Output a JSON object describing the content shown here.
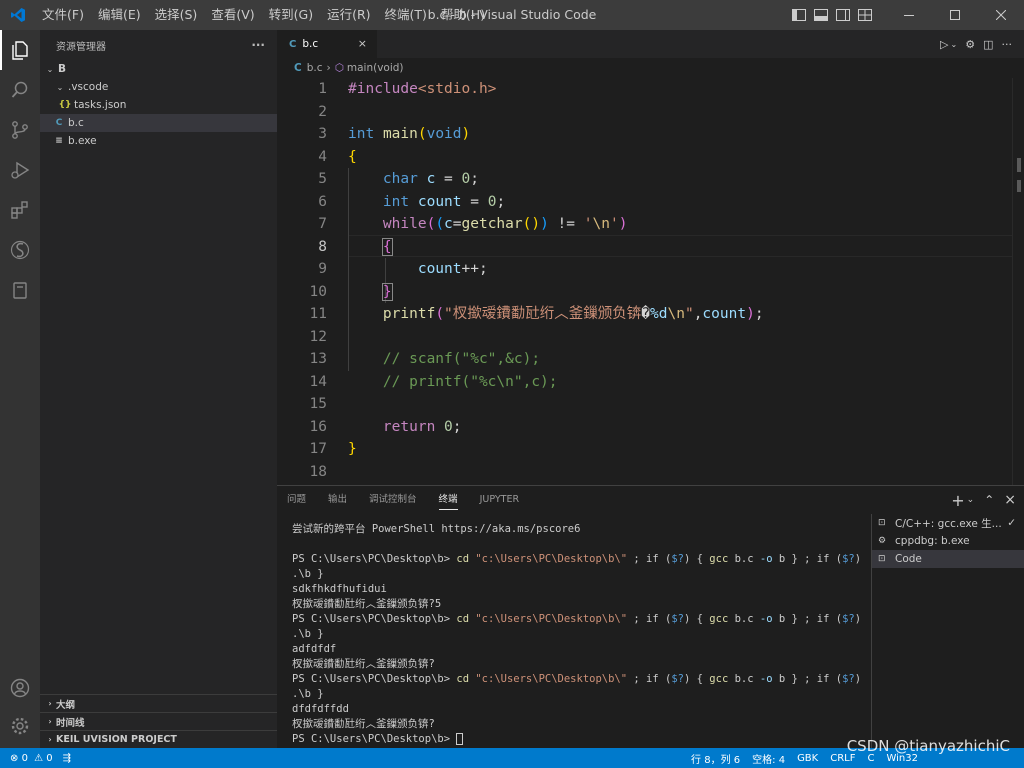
{
  "titlebar": {
    "menu": [
      "文件(F)",
      "编辑(E)",
      "选择(S)",
      "查看(V)",
      "转到(G)",
      "运行(R)",
      "终端(T)",
      "帮助(H)"
    ],
    "title": "b.c - b - Visual Studio Code"
  },
  "sidebar": {
    "header": "资源管理器",
    "more": "···",
    "tree": [
      {
        "label": "B",
        "twisty": "⌄",
        "icon": ""
      },
      {
        "label": ".vscode",
        "twisty": "⌄",
        "icon": ""
      },
      {
        "label": "tasks.json",
        "twisty": "",
        "icon": "{}"
      },
      {
        "label": "b.c",
        "twisty": "",
        "icon": "C"
      },
      {
        "label": "b.exe",
        "twisty": "",
        "icon": "≡"
      }
    ],
    "panels": [
      "大纲",
      "时间线",
      "KEIL UVISION PROJECT"
    ]
  },
  "editor": {
    "tab": {
      "icon": "C",
      "label": "b.c",
      "close": "×"
    },
    "breadcrumb": {
      "file": "b.c",
      "symbol": "main(void)",
      "sep": "›"
    },
    "line_numbers": [
      "1",
      "2",
      "3",
      "4",
      "5",
      "6",
      "7",
      "8",
      "9",
      "10",
      "11",
      "12",
      "13",
      "14",
      "15",
      "16",
      "17",
      "18"
    ]
  },
  "panel": {
    "tabs": [
      "问题",
      "输出",
      "调试控制台",
      "终端",
      "JUPYTER"
    ],
    "actions": {
      "add": "+",
      "chevron": "⌄",
      "split": "⌃",
      "close": "×"
    },
    "terminal_lines": [
      "尝试新的跨平台 PowerShell https://aka.ms/pscore6",
      "",
      "PS C:\\Users\\PC\\Desktop\\b> cd \"c:\\Users\\PC\\Desktop\\b\\\" ; if ($?) { gcc b.c -o b } ; if ($?) {",
      ".\\b }",
      "sdkfhkdfhufidui",
      "杈撳叆鐨勫瓧绗︿釜鏁颁负锛?5",
      "PS C:\\Users\\PC\\Desktop\\b> cd \"c:\\Users\\PC\\Desktop\\b\\\" ; if ($?) { gcc b.c -o b } ; if ($?) {",
      ".\\b }",
      "adfdfdf",
      "杈撳叆鐨勫瓧绗︿釜鏁颁负锛?",
      "PS C:\\Users\\PC\\Desktop\\b> cd \"c:\\Users\\PC\\Desktop\\b\\\" ; if ($?) { gcc b.c -o b } ; if ($?) {",
      ".\\b }",
      "dfdfdffdd",
      "杈撳叆鐨勫瓧绗︿釜鏁颁负锛?",
      "PS C:\\Users\\PC\\Desktop\\b> "
    ],
    "terminal_list": [
      {
        "label": "C/C++: gcc.exe 生...",
        "check": "✓"
      },
      {
        "label": "cppdbg: b.exe",
        "check": ""
      },
      {
        "label": "Code",
        "check": ""
      }
    ]
  },
  "statusbar": {
    "errors": "0",
    "warnings": "0",
    "position": "行 8，列 6",
    "spaces": "空格: 4",
    "encoding": "GBK",
    "eol": "CRLF",
    "language": "C",
    "platform": "Win32"
  },
  "watermark": "CSDN @tianyazhichiC",
  "colors": {
    "titlebar": "#3c3c3c",
    "activitybar": "#333333",
    "sidebar": "#252526",
    "editor": "#1e1e1e",
    "statusbar": "#007acc",
    "accent_icon": "#0078d4"
  },
  "icons": {
    "activity": [
      "explorer-icon",
      "search-icon",
      "source-control-icon",
      "run-debug-icon",
      "extensions-icon",
      "remote-icon",
      "testing-icon",
      "account-icon",
      "settings-icon"
    ]
  }
}
